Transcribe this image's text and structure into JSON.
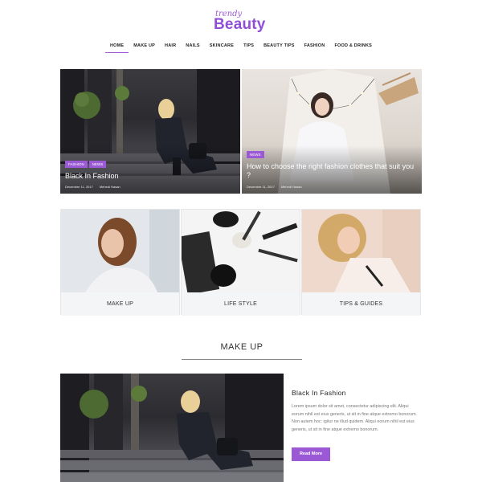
{
  "logo": {
    "small": "trendy",
    "big": "Beauty"
  },
  "nav": {
    "items": [
      {
        "label": "HOME"
      },
      {
        "label": "MAKE UP"
      },
      {
        "label": "HAIR"
      },
      {
        "label": "NAILS"
      },
      {
        "label": "SKINCARE"
      },
      {
        "label": "TIPS"
      },
      {
        "label": "BEAUTY TIPS"
      },
      {
        "label": "FASHION"
      },
      {
        "label": "FOOD & DRINKS"
      }
    ]
  },
  "hero": [
    {
      "badges": [
        "FASHION",
        "NEWS"
      ],
      "title": "Black In Fashion",
      "date": "December 11, 2017",
      "author": "Mehedi Hasan"
    },
    {
      "badges": [
        "NEWS"
      ],
      "title": "How to choose the right fashion clothes that suit you ?",
      "date": "December 11, 2017",
      "author": "Mehedi Hasan"
    }
  ],
  "categories": [
    {
      "label": "MAKE UP"
    },
    {
      "label": "LIFE STYLE"
    },
    {
      "label": "TIPS & GUIDES"
    }
  ],
  "section": {
    "title": "MAKE UP"
  },
  "article": {
    "title": "Black In Fashion",
    "excerpt": "Lorem ipsum dolor sit amet, consectetur adipiscing elit. Aliqui eorum nihil est eius generis, ut sit in fine atque extremo bonorum. Non autem hoc: igitur ne illud quidem. Aliqui eorum nihil est eius generis, ut sit in fine atque extremo bonorum.",
    "button": "Read More"
  }
}
